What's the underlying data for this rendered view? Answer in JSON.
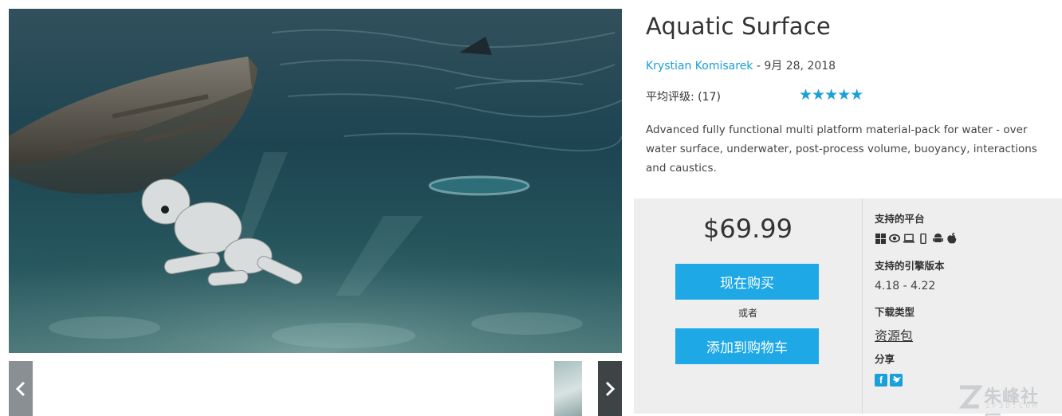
{
  "product": {
    "title": "Aquatic Surface",
    "author": "Krystian Komisarek",
    "separator": " - ",
    "date": "9月 28, 2018",
    "rating_label": "平均评级: (17)",
    "stars": "★★★★★",
    "description": "Advanced fully functional multi platform material-pack for water - over water surface, underwater, post-process volume, buoyancy, interactions and caustics."
  },
  "purchase": {
    "price": "$69.99",
    "buy_now": "现在购买",
    "or": "或者",
    "add_to_cart": "添加到购物车"
  },
  "meta": {
    "platform_label": "支持的平台",
    "platform_icons": [
      "windows-icon",
      "vr-eye-icon",
      "laptop-icon",
      "mobile-icon",
      "android-icon",
      "apple-icon"
    ],
    "engine_label": "支持的引擎版本",
    "engine_version": "4.18 - 4.22",
    "download_label": "下载类型",
    "download_type": "资源包",
    "share_label": "分享",
    "share_icons": [
      "facebook-icon",
      "twitter-icon"
    ]
  },
  "watermark": {
    "text": "朱峰社区",
    "sub": "ZF3D.COM"
  },
  "colors": {
    "accent": "#1ea8e6",
    "link": "#1aa0d8",
    "panel": "#eeeeee"
  }
}
